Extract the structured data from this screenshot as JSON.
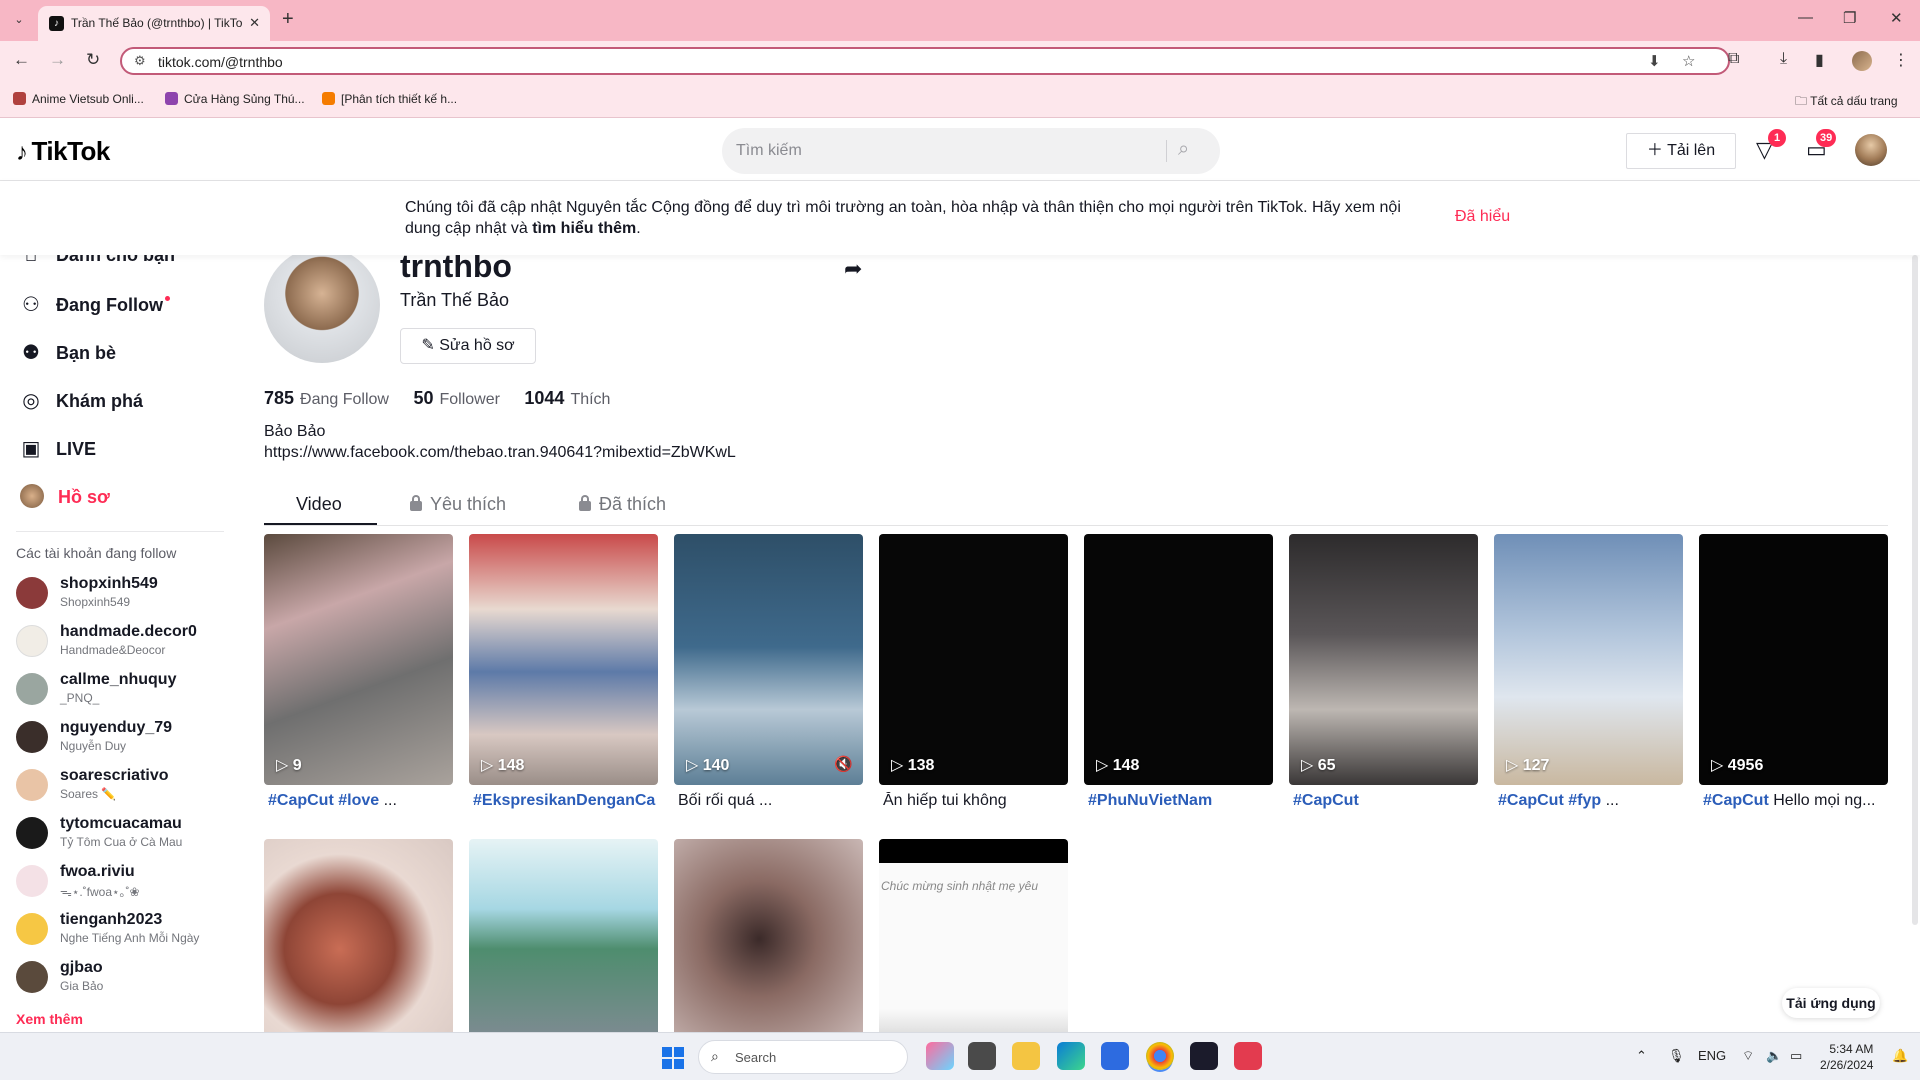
{
  "browser": {
    "tab_title": "Trần Thế Bảo (@trnthbo) | TikTok",
    "url": "tiktok.com/@trnthbo",
    "bookmarks": [
      {
        "label": "Anime Vietsub Onli...",
        "color": "#b0413e"
      },
      {
        "label": "Cửa Hàng Sủng Thú...",
        "color": "#8e44ad"
      },
      {
        "label": "[Phân tích thiết kế h...",
        "color": "#f57c00"
      }
    ],
    "all_bookmarks": "Tất cả dấu trang"
  },
  "header": {
    "logo": "TikTok",
    "search_placeholder": "Tìm kiếm",
    "upload_label": "Tải lên",
    "inbox_badge": "1",
    "messages_badge": "39"
  },
  "notice": {
    "text_before": "Chúng tôi đã cập nhật Nguyên tắc Cộng đồng để duy trì môi trường an toàn, hòa nhập và thân thiện cho mọi người trên TikTok. Hãy xem nội dung cập nhật và ",
    "link": "tìm hiểu thêm",
    "text_after": ".",
    "dismiss": "Đã hiểu"
  },
  "sidebar": {
    "items": [
      {
        "label": "Dành cho bạn",
        "icon": "home-icon"
      },
      {
        "label": "Đang Follow",
        "icon": "following-icon"
      },
      {
        "label": "Bạn bè",
        "icon": "friends-icon"
      },
      {
        "label": "Khám phá",
        "icon": "explore-icon"
      },
      {
        "label": "LIVE",
        "icon": "live-icon"
      },
      {
        "label": "Hồ sơ",
        "icon": "profile-avatar-icon"
      }
    ],
    "following_title": "Các tài khoản đang follow",
    "accounts": [
      {
        "name": "shopxinh549",
        "sub": "Shopxinh549",
        "color": "#8b3a3a"
      },
      {
        "name": "handmade.decor0",
        "sub": "Handmade&Deocor",
        "color": "#f1ede6"
      },
      {
        "name": "callme_nhuquy",
        "sub": "_PNQ_",
        "color": "#9aa6a0"
      },
      {
        "name": "nguyenduy_79",
        "sub": "Nguyễn Duy",
        "color": "#3a2e2a"
      },
      {
        "name": "soarescriativo",
        "sub": "Soares ✏️",
        "color": "#e9c4a6"
      },
      {
        "name": "tytomcuacamau",
        "sub": "Tỷ Tôm Cua ở Cà Mau",
        "color": "#1a1a1a"
      },
      {
        "name": "fwoa.riviu",
        "sub": "ᯓ⋆.˚fwoa⋆｡˚❀",
        "color": "#f4e1e6"
      },
      {
        "name": "tienganh2023",
        "sub": "Nghe Tiếng Anh Mỗi Ngày",
        "color": "#f6c744"
      },
      {
        "name": "gjbao",
        "sub": "Gia Bảo",
        "color": "#5a4a3c"
      }
    ],
    "see_more": "Xem thêm"
  },
  "profile": {
    "username": "trnthbo",
    "nickname": "Trần Thế Bảo",
    "edit_label": "Sửa hồ sơ",
    "following_count": "785",
    "following_label": "Đang Follow",
    "followers_count": "50",
    "followers_label": "Follower",
    "likes_count": "1044",
    "likes_label": "Thích",
    "bio_line1": "Bảo Bảo",
    "bio_line2": "https://www.facebook.com/thebao.tran.940641?mibextid=ZbWKwL"
  },
  "tabs": {
    "videos": "Video",
    "favorites": "Yêu thích",
    "liked": "Đã thích"
  },
  "videos": [
    {
      "plays": "9",
      "tags": "#CapCut #love",
      "text": " ...",
      "bg": "linear-gradient(160deg,#5b4a3e 0%,#c8a7a8 30%,#6f6f6f 60%,#a9a29c 100%)"
    },
    {
      "plays": "148",
      "tags": "#EkspresikanDenganCa",
      "text": "",
      "bg": "linear-gradient(180deg,#c94a4a 0%,#e8d9d0 30%,#5d7aa8 55%,#d8c8c2 80%,#9a8e88 100%)"
    },
    {
      "plays": "140",
      "tags": "",
      "text": "Bối rối quá ...",
      "bg": "linear-gradient(180deg,#2e4f68 0%,#3f6a8c 45%,#b8c9d6 70%,#5d7f96 100%)"
    },
    {
      "plays": "138",
      "tags": "",
      "text": "Ăn hiếp tui không",
      "bg": "#070707"
    },
    {
      "plays": "148",
      "tags": "#PhuNuVietNam",
      "text": "",
      "bg": "#060606"
    },
    {
      "plays": "65",
      "tags": "#CapCut",
      "text": "",
      "bg": "linear-gradient(180deg,#2d2b2c 0%,#5a5658 40%,#bdb7b2 70%,#3a3737 100%)"
    },
    {
      "plays": "127",
      "tags": "#CapCut #fyp",
      "text": " ...",
      "bg": "linear-gradient(180deg,#6f8fb7 0%,#b3c6dc 40%,#dfe6ee 65%,#c9b8a0 100%)"
    },
    {
      "plays": "4956",
      "tags": "#CapCut",
      "text": " Hello mọi ng...",
      "bg": "#050505"
    },
    {
      "plays": "",
      "tags": "",
      "text": "",
      "bg": "radial-gradient(circle at 40% 55%,#c96d55 0,#8e4536 35%,#e9d9d2 60%,#d9c9c3 100%)"
    },
    {
      "plays": "",
      "tags": "",
      "text": "",
      "bg": "linear-gradient(180deg,#e6f3f5 0%,#a6d7e3 35%,#4e8d6e 55%,#7e8b92 100%)"
    },
    {
      "plays": "",
      "tags": "",
      "text": "",
      "bg": "radial-gradient(circle at 45% 50%,#3b2a29 0,#8a6a63 40%,#c9b7b4 100%)"
    },
    {
      "plays": "",
      "tags": "",
      "text": "",
      "bg": "linear-gradient(180deg,#000 0%,#000 12%,#fafafa 12%,#fafafa 85%,#d9d9d9 100%)",
      "overlay": "Chúc mừng sinh nhật mẹ yêu"
    }
  ],
  "get_app": "Tải ứng dụng",
  "taskbar": {
    "search": "Search",
    "lang": "ENG",
    "time": "5:34 AM",
    "date": "2/26/2024"
  }
}
